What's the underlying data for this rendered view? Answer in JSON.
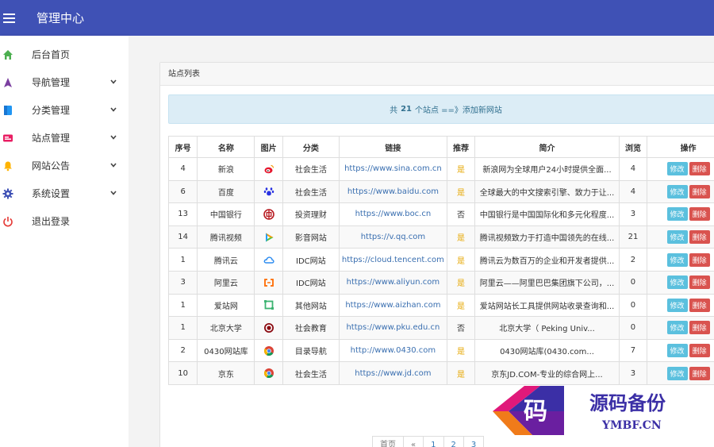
{
  "app": {
    "title": "管理中心"
  },
  "sidebar": {
    "items": [
      {
        "label": "后台首页",
        "icon": "home-icon",
        "color": "#4caf50",
        "expandable": false
      },
      {
        "label": "导航管理",
        "icon": "navigation-icon",
        "color": "#7b3fa0",
        "expandable": true
      },
      {
        "label": "分类管理",
        "icon": "category-icon",
        "color": "#2196f3",
        "expandable": true
      },
      {
        "label": "站点管理",
        "icon": "site-icon",
        "color": "#e91e63",
        "expandable": true
      },
      {
        "label": "网站公告",
        "icon": "bell-icon",
        "color": "#ffb300",
        "expandable": true
      },
      {
        "label": "系统设置",
        "icon": "gear-icon",
        "color": "#3f51b5",
        "expandable": true
      },
      {
        "label": "退出登录",
        "icon": "power-icon",
        "color": "#e53935",
        "expandable": false
      }
    ]
  },
  "panel": {
    "title": "站点列表"
  },
  "info": {
    "prefix": "共",
    "count": "21",
    "suffix": "个站点 ==》",
    "link": "添加新网站"
  },
  "table": {
    "headers": [
      "序号",
      "名称",
      "图片",
      "分类",
      "链接",
      "推荐",
      "简介",
      "浏览",
      "操作"
    ],
    "rows": [
      {
        "id": "4",
        "name": "新浪",
        "icon": "weibo-icon",
        "category": "社会生活",
        "url": "https://www.sina.com.cn",
        "recommend": "是",
        "desc": "新浪网为全球用户24小时提供全面...",
        "views": "4"
      },
      {
        "id": "6",
        "name": "百度",
        "icon": "baidu-icon",
        "category": "社会生活",
        "url": "https://www.baidu.com",
        "recommend": "是",
        "desc": "全球最大的中文搜索引擎、致力于让...",
        "views": "4"
      },
      {
        "id": "13",
        "name": "中国银行",
        "icon": "boc-icon",
        "category": "投资理财",
        "url": "https://www.boc.cn",
        "recommend": "否",
        "desc": "中国银行是中国国际化和多元化程度...",
        "views": "3"
      },
      {
        "id": "14",
        "name": "腾讯视频",
        "icon": "tencent-video-icon",
        "category": "影音网站",
        "url": "https://v.qq.com",
        "recommend": "是",
        "desc": "腾讯视频致力于打造中国领先的在线...",
        "views": "21"
      },
      {
        "id": "1",
        "name": "腾讯云",
        "icon": "tencent-cloud-icon",
        "category": "IDC网站",
        "url": "https://cloud.tencent.com",
        "recommend": "是",
        "desc": "腾讯云为数百万的企业和开发者提供...",
        "views": "2"
      },
      {
        "id": "3",
        "name": "阿里云",
        "icon": "aliyun-icon",
        "category": "IDC网站",
        "url": "https://www.aliyun.com",
        "recommend": "是",
        "desc": "阿里云——阿里巴巴集团旗下公司，...",
        "views": "0"
      },
      {
        "id": "1",
        "name": "爱站网",
        "icon": "aizhan-icon",
        "category": "其他网站",
        "url": "https://www.aizhan.com",
        "recommend": "是",
        "desc": "爱站网站长工具提供网站收录查询和...",
        "views": "0"
      },
      {
        "id": "1",
        "name": "北京大学",
        "icon": "pku-icon",
        "category": "社会教育",
        "url": "https://www.pku.edu.cn",
        "recommend": "否",
        "desc": "北京大学（ Peking Univ...",
        "views": "0"
      },
      {
        "id": "2",
        "name": "0430网站库",
        "icon": "chrome-icon",
        "category": "目录导航",
        "url": "http://www.0430.com",
        "recommend": "是",
        "desc": "0430网站库(0430.com...",
        "views": "7"
      },
      {
        "id": "10",
        "name": "京东",
        "icon": "chrome-icon",
        "category": "社会生活",
        "url": "https://www.jd.com",
        "recommend": "是",
        "desc": "京东JD.COM-专业的综合网上...",
        "views": "3"
      }
    ],
    "edit_label": "修改",
    "delete_label": "删除"
  },
  "pagination": {
    "items": [
      "首页",
      "«",
      "1",
      "2",
      "3"
    ]
  },
  "watermark": {
    "cn": "源码备份",
    "en": "YMBF.CN",
    "glyph": "码"
  }
}
